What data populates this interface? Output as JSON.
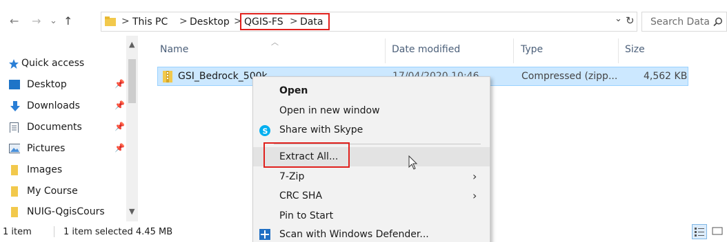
{
  "navigation": {
    "back_glyph": "←",
    "forward_glyph": "→",
    "recent_glyph": "⌄",
    "up_glyph": "↑"
  },
  "address_bar": {
    "breadcrumb": [
      "This PC",
      "Desktop",
      "QGIS-FS",
      "Data"
    ],
    "separator": ">",
    "highlight_color": "#e0201c",
    "dropdown_glyph": "⌄",
    "refresh_glyph": "↻"
  },
  "search": {
    "placeholder": "Search Data",
    "icon": "search-icon"
  },
  "sidebar": {
    "quick_access_label": "Quick access",
    "items": [
      {
        "label": "Desktop",
        "icon": "desktop-icon",
        "pinned": true
      },
      {
        "label": "Downloads",
        "icon": "download-icon",
        "pinned": true
      },
      {
        "label": "Documents",
        "icon": "documents-icon",
        "pinned": true
      },
      {
        "label": "Pictures",
        "icon": "pictures-icon",
        "pinned": true
      },
      {
        "label": "Images",
        "icon": "folder-icon",
        "pinned": false
      },
      {
        "label": "My Course",
        "icon": "folder-icon",
        "pinned": false
      },
      {
        "label": "NUIG-QgisCours",
        "icon": "folder-icon",
        "pinned": false
      }
    ]
  },
  "file_list": {
    "columns": [
      "Name",
      "Date modified",
      "Type",
      "Size"
    ],
    "rows": [
      {
        "name": "GSI_Bedrock_500k",
        "date": "17/04/2020 10:46",
        "type": "Compressed (zipp...",
        "size": "4,562 KB",
        "selected": true
      }
    ],
    "selection_color": "#cce8ff"
  },
  "context_menu": {
    "items": [
      {
        "label": "Open",
        "bold": true
      },
      {
        "label": "Open in new window"
      },
      {
        "label": "Share with Skype",
        "icon": "skype-icon"
      },
      {
        "label": "Extract All...",
        "highlighted": true
      },
      {
        "label": "7-Zip",
        "submenu": true
      },
      {
        "label": "CRC SHA",
        "submenu": true
      },
      {
        "label": "Pin to Start"
      },
      {
        "label": "Scan with Windows Defender...",
        "icon": "shield-icon"
      }
    ]
  },
  "status_bar": {
    "item_count": "1 item",
    "selection": "1 item selected  4.45 MB"
  }
}
